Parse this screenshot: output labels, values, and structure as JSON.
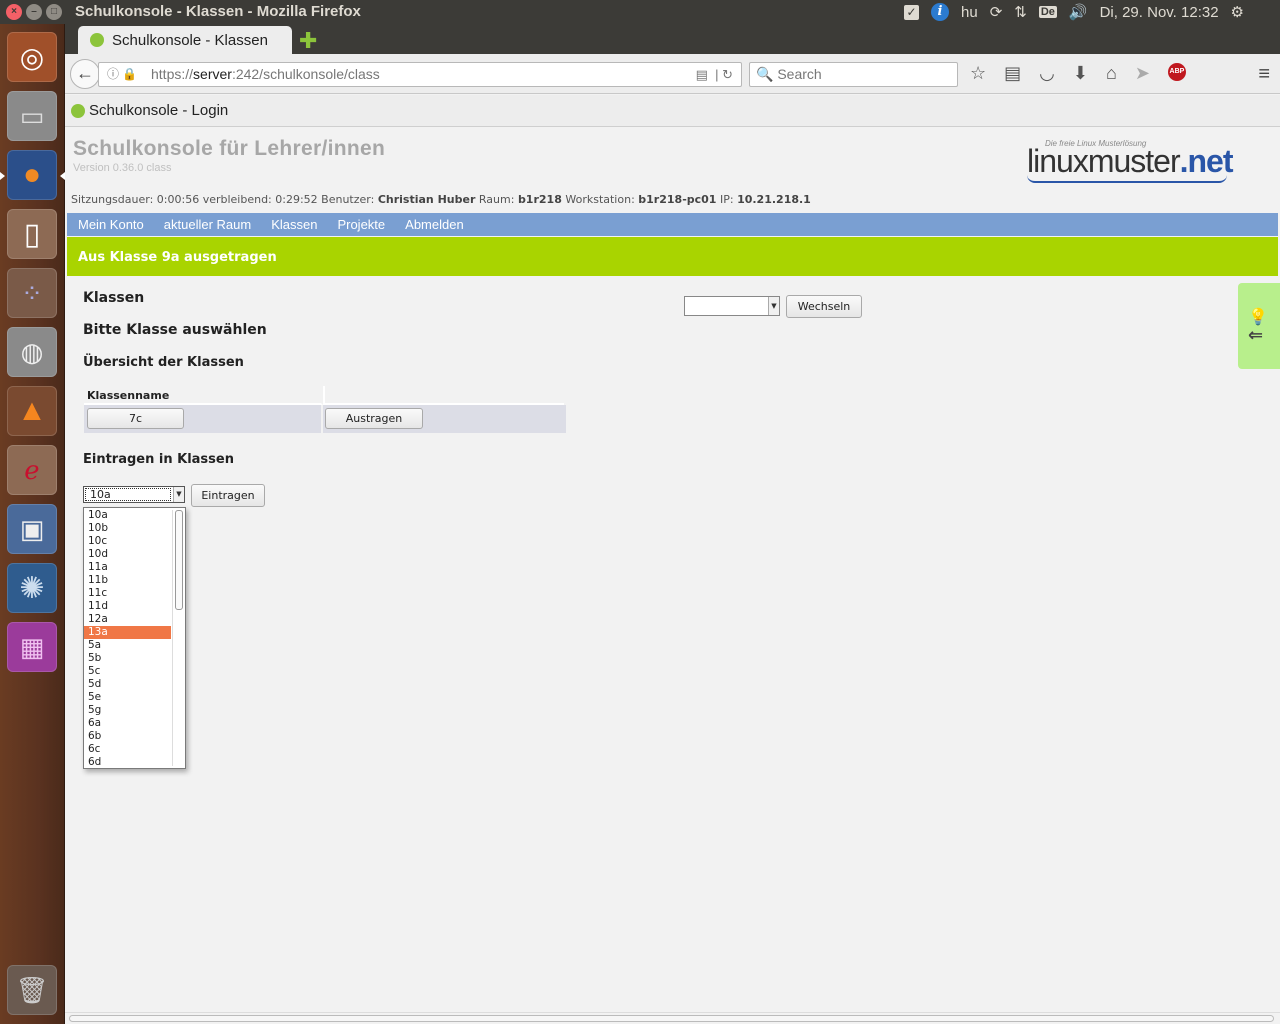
{
  "os": {
    "window_title": "Schulkonsole - Klassen - Mozilla Firefox",
    "tray": {
      "lang": "hu",
      "kbd": "De",
      "datetime": "Di, 29. Nov. 12:32"
    }
  },
  "browser": {
    "tab_title": "Schulkonsole - Klassen",
    "url_host": "server",
    "url_rest": ":242/schulkonsole/class",
    "url_prefix": "https://",
    "search_placeholder": "Search",
    "bookmark_label": "Schulkonsole - Login"
  },
  "page": {
    "title": "Schulkonsole für Lehrer/innen",
    "version": "Version 0.36.0 class",
    "logo_tag": "Die freie Linux Musterlösung",
    "logo_main": "linuxmuster",
    "logo_net": ".net",
    "session": {
      "dauer_label": "Sitzungsdauer:",
      "dauer": "0:00:56",
      "verbleibend_label": "verbleibend:",
      "verbleibend": "0:29:52",
      "benutzer_label": "Benutzer:",
      "benutzer": "Christian Huber",
      "raum_label": "Raum:",
      "raum": "b1r218",
      "workstation_label": "Workstation:",
      "workstation": "b1r218-pc01",
      "ip_label": "IP:",
      "ip": "10.21.218.1"
    },
    "menu": [
      "Mein Konto",
      "aktueller Raum",
      "Klassen",
      "Projekte",
      "Abmelden"
    ],
    "notice": "Aus Klasse 9a ausgetragen",
    "heading_klassen": "Klassen",
    "heading_bitte": "Bitte Klasse auswählen",
    "heading_uebersicht": "Übersicht der Klassen",
    "table": {
      "col1": "Klassenname",
      "col2": "",
      "rows": [
        {
          "klasse": "7c",
          "action": "Austragen"
        }
      ]
    },
    "wechseln_label": "Wechseln",
    "wechseln_value": "",
    "heading_eintragen": "Eintragen in Klassen",
    "eintragen_select_value": "10a",
    "eintragen_label": "Eintragen",
    "dropdown_options": [
      "10a",
      "10b",
      "10c",
      "10d",
      "11a",
      "11b",
      "11c",
      "11d",
      "12a",
      "13a",
      "5a",
      "5b",
      "5c",
      "5d",
      "5e",
      "5g",
      "6a",
      "6b",
      "6c",
      "6d"
    ],
    "dropdown_highlighted": "13a"
  }
}
